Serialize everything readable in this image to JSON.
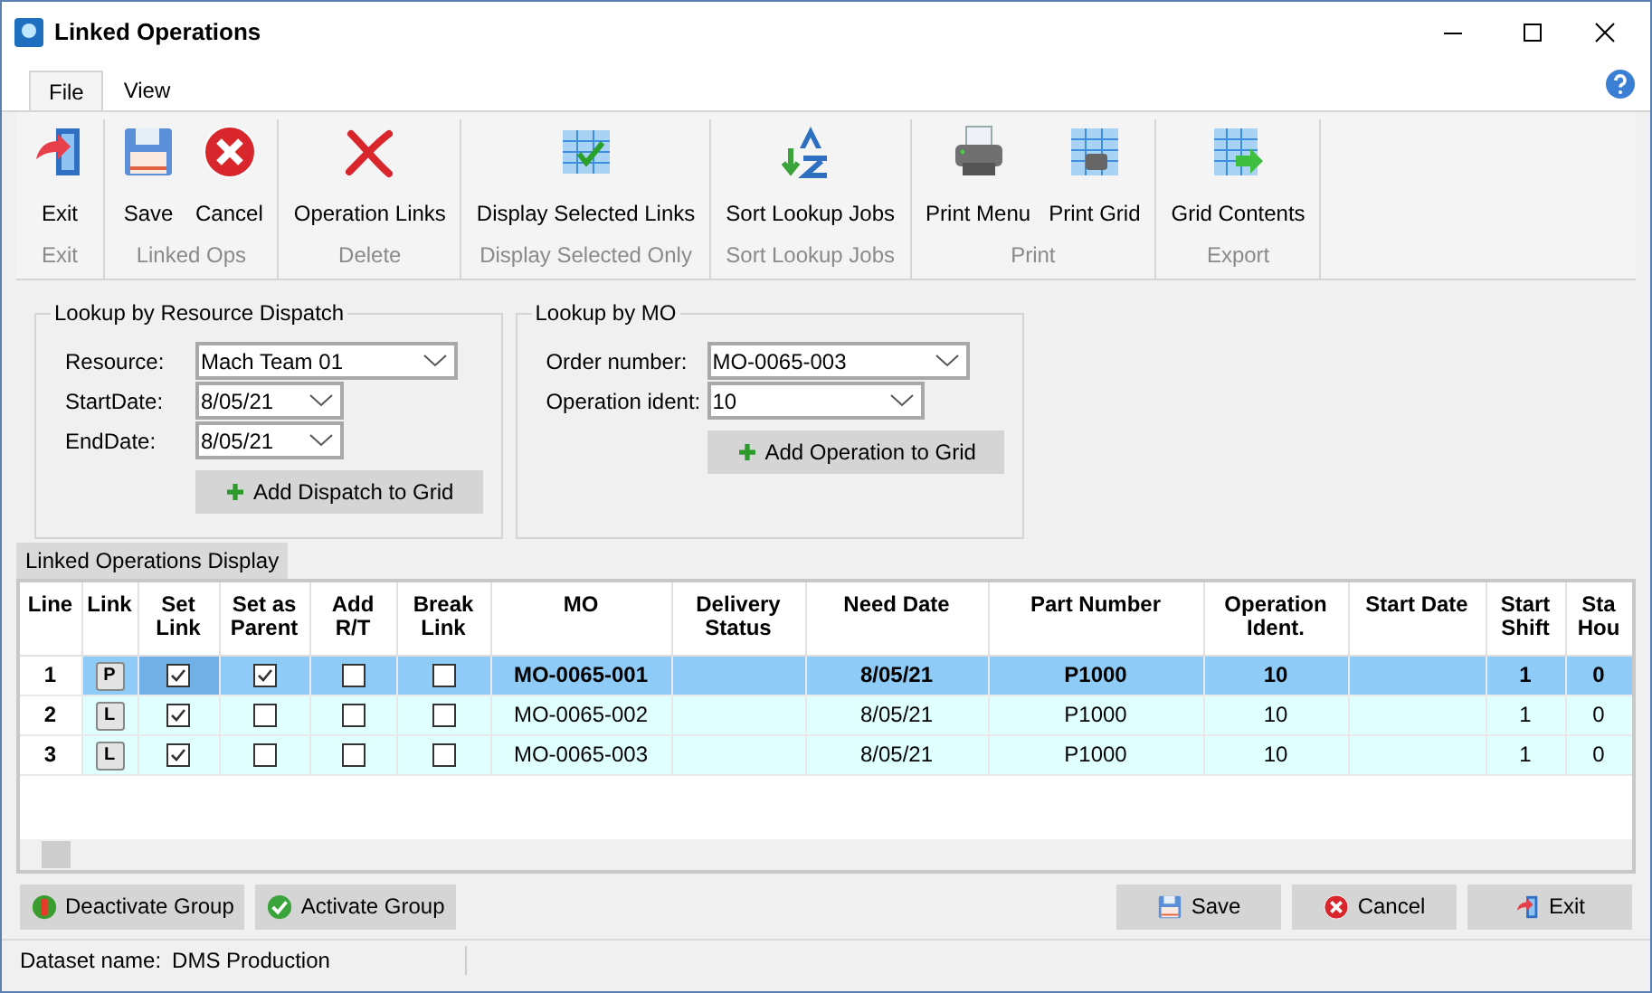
{
  "window": {
    "title": "Linked Operations"
  },
  "menu_tabs": [
    {
      "label": "File",
      "selected": true
    },
    {
      "label": "View",
      "selected": false
    }
  ],
  "ribbon_groups": [
    {
      "label": "Exit",
      "buttons": [
        {
          "label": "Exit",
          "kind": "exit"
        }
      ]
    },
    {
      "label": "Linked Ops",
      "buttons": [
        {
          "label": "Save",
          "kind": "save"
        },
        {
          "label": "Cancel",
          "kind": "cancel"
        }
      ]
    },
    {
      "label": "Delete",
      "buttons": [
        {
          "label": "Operation Links",
          "kind": "delete"
        }
      ]
    },
    {
      "label": "Display Selected Only",
      "buttons": [
        {
          "label": "Display Selected Links",
          "kind": "gridcheck"
        }
      ]
    },
    {
      "label": "Sort Lookup Jobs",
      "buttons": [
        {
          "label": "Sort Lookup Jobs",
          "kind": "sort"
        }
      ]
    },
    {
      "label": "Print",
      "buttons": [
        {
          "label": "Print Menu",
          "kind": "printer"
        },
        {
          "label": "Print Grid",
          "kind": "printgrid"
        }
      ]
    },
    {
      "label": "Export",
      "buttons": [
        {
          "label": "Grid Contents",
          "kind": "export"
        }
      ]
    }
  ],
  "lookup_by_resource": {
    "title": "Lookup by Resource Dispatch",
    "fields": [
      {
        "label": "Resource:",
        "value": "Mach Team 01",
        "kind": "wide"
      },
      {
        "label": "StartDate:",
        "value": "8/05/21",
        "kind": "date"
      },
      {
        "label": "EndDate:",
        "value": "8/05/21",
        "kind": "date"
      }
    ],
    "button": "Add Dispatch to Grid"
  },
  "lookup_by_mo": {
    "title": "Lookup by MO",
    "fields": [
      {
        "label": "Order number:",
        "value": "MO-0065-003",
        "kind": "wide"
      },
      {
        "label": "Operation ident:",
        "value": "10",
        "kind": "mid"
      }
    ],
    "button": "Add Operation to Grid"
  },
  "grid": {
    "tab": "Linked Operations Display",
    "columns": [
      "Line",
      "Link",
      "Set Link",
      "Set as Parent",
      "Add R/T",
      "Break Link",
      "MO",
      "Delivery Status",
      "Need Date",
      "Part Number",
      "Operation Ident.",
      "Start Date",
      "Start Shift",
      "Sta Hou"
    ],
    "rows": [
      {
        "selected": true,
        "cells": [
          {
            "kind": "text",
            "text": "1"
          },
          {
            "kind": "link",
            "text": "P"
          },
          {
            "kind": "check",
            "checked": true
          },
          {
            "kind": "check",
            "checked": true
          },
          {
            "kind": "check",
            "checked": false
          },
          {
            "kind": "check",
            "checked": false
          },
          {
            "kind": "text",
            "text": "MO-0065-001"
          },
          {
            "kind": "empty"
          },
          {
            "kind": "text",
            "text": "8/05/21"
          },
          {
            "kind": "text",
            "text": "P1000"
          },
          {
            "kind": "text",
            "text": "10"
          },
          {
            "kind": "empty"
          },
          {
            "kind": "text",
            "text": "1"
          },
          {
            "kind": "text",
            "text": "0"
          }
        ]
      },
      {
        "selected": false,
        "cells": [
          {
            "kind": "text",
            "text": "2"
          },
          {
            "kind": "link",
            "text": "L"
          },
          {
            "kind": "check",
            "checked": true
          },
          {
            "kind": "check",
            "checked": false
          },
          {
            "kind": "check",
            "checked": false
          },
          {
            "kind": "check",
            "checked": false
          },
          {
            "kind": "text",
            "text": "MO-0065-002"
          },
          {
            "kind": "empty"
          },
          {
            "kind": "text",
            "text": "8/05/21"
          },
          {
            "kind": "text",
            "text": "P1000"
          },
          {
            "kind": "text",
            "text": "10"
          },
          {
            "kind": "empty"
          },
          {
            "kind": "text",
            "text": "1"
          },
          {
            "kind": "text",
            "text": "0"
          }
        ]
      },
      {
        "selected": false,
        "cells": [
          {
            "kind": "text",
            "text": "3"
          },
          {
            "kind": "link",
            "text": "L"
          },
          {
            "kind": "check",
            "checked": true
          },
          {
            "kind": "check",
            "checked": false
          },
          {
            "kind": "check",
            "checked": false
          },
          {
            "kind": "check",
            "checked": false
          },
          {
            "kind": "text",
            "text": "MO-0065-003"
          },
          {
            "kind": "empty"
          },
          {
            "kind": "text",
            "text": "8/05/21"
          },
          {
            "kind": "text",
            "text": "P1000"
          },
          {
            "kind": "text",
            "text": "10"
          },
          {
            "kind": "empty"
          },
          {
            "kind": "text",
            "text": "1"
          },
          {
            "kind": "text",
            "text": "0"
          }
        ]
      }
    ]
  },
  "left_buttons": [
    {
      "label": "Deactivate Group",
      "kind": "deactivate"
    },
    {
      "label": "Activate Group",
      "kind": "activate"
    }
  ],
  "right_buttons": [
    {
      "label": "Save",
      "kind": "save"
    },
    {
      "label": "Cancel",
      "kind": "cancel"
    },
    {
      "label": "Exit",
      "kind": "exit"
    }
  ],
  "status_bar": {
    "label": "Dataset name:",
    "value": "DMS Production"
  }
}
